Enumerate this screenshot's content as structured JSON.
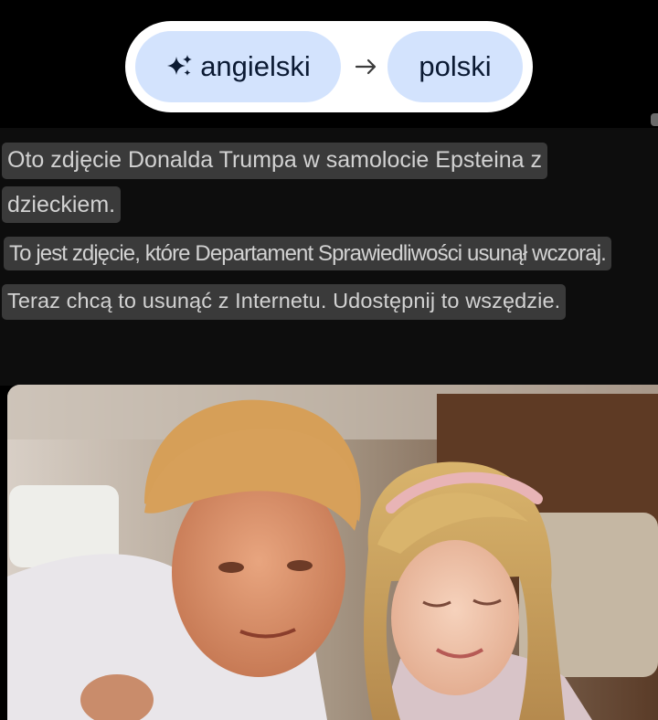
{
  "language_switcher": {
    "source_language": "angielski",
    "target_language": "polski",
    "source_icon": "sparkle-icon",
    "swap_icon": "arrow-right-icon",
    "chip_color": "#d3e3fd"
  },
  "translated_text": {
    "line1": "Oto zdjęcie Donalda Trumpa w samolocie Epsteina z",
    "line2": "dzieckiem.",
    "line3": "To jest zdjęcie, które Departament Sprawiedliwości usunął wczoraj.",
    "line4": "Teraz chcą to usunąć z Internetu. Udostępnij to wszędzie."
  },
  "colors": {
    "background": "#000000",
    "text_highlight": "#3a3a3a",
    "text": "#d2d2d2"
  }
}
